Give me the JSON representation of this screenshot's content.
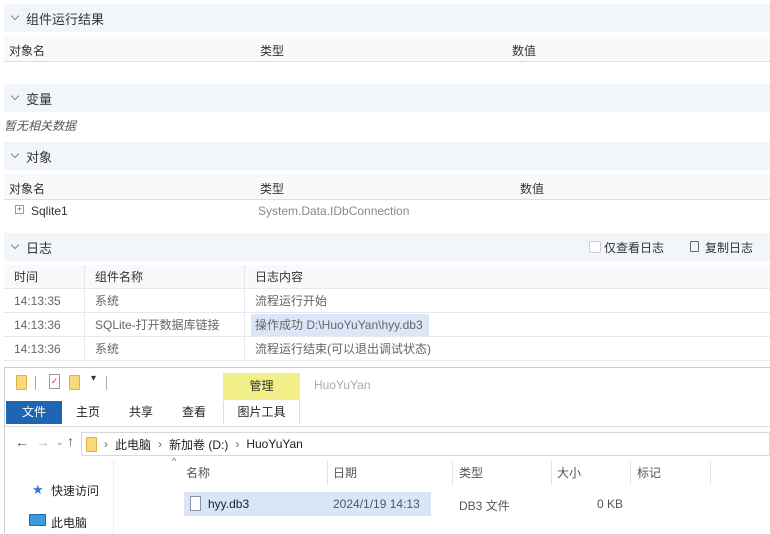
{
  "results": {
    "title": "组件运行结果",
    "columns": [
      "对象名",
      "类型",
      "数值"
    ]
  },
  "variables": {
    "title": "变量",
    "empty": "暂无相关数据"
  },
  "objects": {
    "title": "对象",
    "columns": [
      "对象名",
      "类型",
      "数值"
    ],
    "rows": [
      {
        "name": "Sqlite1",
        "type": "System.Data.IDbConnection",
        "value": ""
      }
    ]
  },
  "log": {
    "title": "日志",
    "only_log_label": "仅查看日志",
    "only_log_checked": false,
    "copy_label": "复制日志",
    "columns": [
      "时间",
      "组件名称",
      "日志内容"
    ],
    "rows": [
      {
        "time": "14:13:35",
        "component": "系统",
        "content": "流程运行开始"
      },
      {
        "time": "14:13:36",
        "component": "SQLite-打开数据库链接",
        "content": "操作成功 D:\\HuoYuYan\\hyy.db3"
      },
      {
        "time": "14:13:36",
        "component": "系统",
        "content": "流程运行结束(可以退出调试状态)"
      }
    ]
  },
  "explorer": {
    "context_tab": "管理",
    "window_title": "HuoYuYan",
    "tabs": [
      "文件",
      "主页",
      "共享",
      "查看",
      "图片工具"
    ],
    "breadcrumb": [
      "此电脑",
      "新加卷 (D:)",
      "HuoYuYan"
    ],
    "columns": [
      "名称",
      "日期",
      "类型",
      "大小",
      "标记"
    ],
    "sidebar": [
      "快速访问",
      "此电脑"
    ],
    "files": [
      {
        "name": "hyy.db3",
        "date": "2024/1/19 14:13",
        "type": "DB3 文件",
        "size": "0 KB"
      }
    ],
    "colors": {
      "file_tab": "#1e66b4",
      "context_tab": "#f3f08a",
      "selection": "#d9e6f8"
    }
  }
}
